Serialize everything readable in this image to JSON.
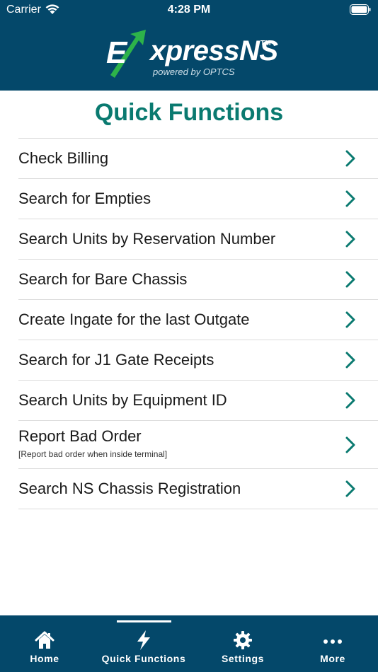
{
  "status_bar": {
    "carrier": "Carrier",
    "time": "4:28 PM"
  },
  "logo": {
    "brand_e": "E",
    "brand_rest": "xpressNS",
    "trademark": "TM",
    "tagline": "powered by OPTCS",
    "arrow_color": "#2db34a"
  },
  "page": {
    "title": "Quick Functions"
  },
  "menu": {
    "items": [
      {
        "label": "Check Billing"
      },
      {
        "label": "Search for Empties"
      },
      {
        "label": "Search Units by Reservation Number"
      },
      {
        "label": "Search for Bare Chassis"
      },
      {
        "label": "Create Ingate for the last Outgate"
      },
      {
        "label": "Search for J1 Gate Receipts"
      },
      {
        "label": "Search Units by Equipment ID"
      },
      {
        "label": "Report Bad Order",
        "subtitle": "[Report bad order when inside terminal]"
      },
      {
        "label": "Search NS Chassis Registration"
      }
    ]
  },
  "tabbar": {
    "tabs": [
      {
        "label": "Home",
        "icon": "home-icon"
      },
      {
        "label": "Quick Functions",
        "icon": "lightning-icon",
        "active": true
      },
      {
        "label": "Settings",
        "icon": "gear-icon"
      },
      {
        "label": "More",
        "icon": "more-dots-icon"
      }
    ]
  },
  "colors": {
    "header_bg": "#04486a",
    "title": "#0a7a70",
    "chevron": "#0a7a70"
  }
}
